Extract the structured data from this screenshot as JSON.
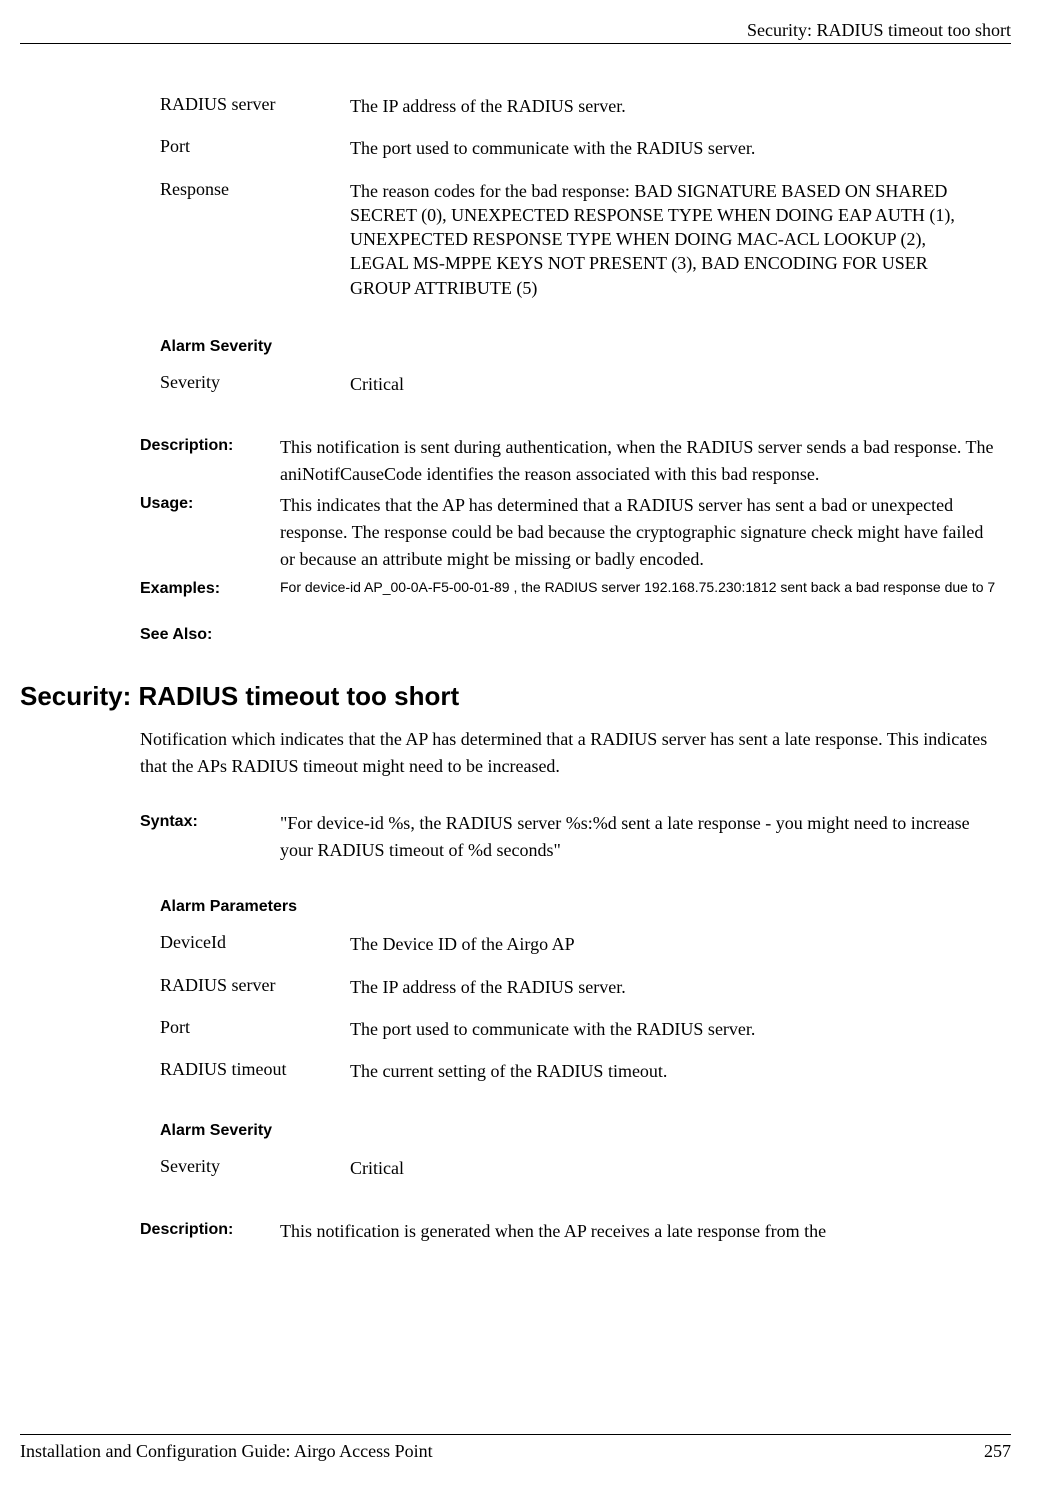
{
  "header": {
    "title": "Security: RADIUS timeout too short"
  },
  "footer": {
    "left": "Installation and Configuration Guide: Airgo Access Point",
    "pageNumber": "257"
  },
  "topParams": [
    {
      "label": "RADIUS server",
      "value": "The IP address of the RADIUS server."
    },
    {
      "label": "Port",
      "value": "The port used to communicate with the RADIUS server."
    },
    {
      "label": "Response",
      "value": "The reason codes for the bad response: BAD SIGNATURE BASED ON SHARED SECRET (0), UNEXPECTED RESPONSE TYPE WHEN DOING EAP AUTH (1), UNEXPECTED RESPONSE TYPE WHEN DOING MAC-ACL LOOKUP (2),  LEGAL MS-MPPE KEYS NOT PRESENT (3), BAD ENCODING FOR USER GROUP ATTRIBUTE (5)"
    }
  ],
  "topSeverity": {
    "heading": "Alarm Severity",
    "label": "Severity",
    "value": "Critical"
  },
  "defs1": {
    "description": {
      "label": "Description:",
      "value": "This notification is sent during authentication, when the RADIUS server sends a bad response. The aniNotifCauseCode identifies the reason associated with this bad response."
    },
    "usage": {
      "label": "Usage:",
      "value": "This indicates that the AP has determined that a RADIUS server has sent a bad or unexpected response. The response could be bad because the cryptographic signature check might have failed or because an attribute might be missing or badly encoded."
    },
    "examples": {
      "label": "Examples:",
      "value": "For device-id AP_00-0A-F5-00-01-89 , the RADIUS server 192.168.75.230:1812 sent back a bad response due to 7"
    },
    "seeAlso": {
      "label": "See Also:"
    }
  },
  "section2": {
    "heading": "Security: RADIUS timeout too short",
    "intro": "Notification which indicates that the AP has determined that a RADIUS server has sent a late response. This indicates that the APs RADIUS timeout might need to be increased.",
    "syntax": {
      "label": "Syntax:",
      "value": "\"For device-id %s, the RADIUS server %s:%d sent a late response - you might need to increase your RADIUS timeout of %d seconds\""
    },
    "alarmParamsHeading": "Alarm Parameters",
    "params": [
      {
        "label": "DeviceId",
        "value": "The Device ID of the Airgo AP"
      },
      {
        "label": "RADIUS server",
        "value": "The IP address of the RADIUS server."
      },
      {
        "label": "Port",
        "value": "The port used to communicate with the RADIUS server."
      },
      {
        "label": "RADIUS timeout",
        "value": "The current setting of the RADIUS timeout."
      }
    ],
    "severity": {
      "heading": "Alarm Severity",
      "label": "Severity",
      "value": "Critical"
    },
    "description": {
      "label": "Description:",
      "value": "This notification is generated when the AP receives a late response from the"
    }
  }
}
